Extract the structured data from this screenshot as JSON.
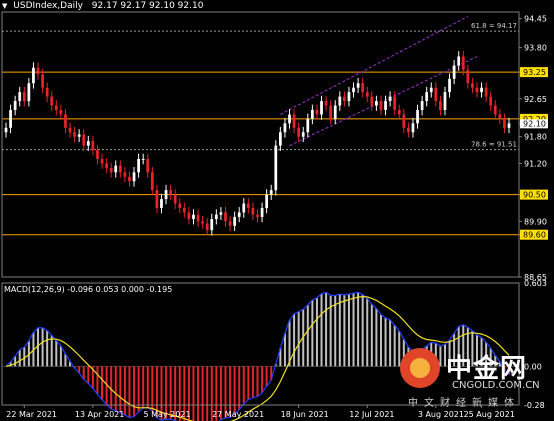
{
  "header": {
    "symbol": "USDIndex,Daily",
    "ohlc": "92.17 92.17 92.10 92.10"
  },
  "colors": {
    "background": "#000000",
    "bull": "#ffffff",
    "bear": "#e8232a",
    "hline": "#ffa500",
    "dash": "#a0a0a0",
    "channel": "#9933cc",
    "macd_hist": "#c0c0c0",
    "macd_hist_neg": "#e8232a",
    "signal": "#f0e020",
    "macd_line": "#2040ff",
    "label_bg": "#ffe000"
  },
  "chart_data": [
    {
      "type": "candlestick",
      "title": "USDIndex,Daily",
      "ylim": [
        88.65,
        94.6
      ],
      "yticks": [
        "94.45",
        "93.80",
        "93.25",
        "92.65",
        "92.20",
        "92.10",
        "91.80",
        "91.20",
        "90.50",
        "89.90",
        "89.60",
        "88.65"
      ],
      "xticks": [
        "22 Mar 2021",
        "13 Apr 2021",
        "5 May 2021",
        "27 May 2021",
        "18 Jun 2021",
        "12 Jul 2021",
        "3 Aug 2021",
        "25 Aug 2021"
      ],
      "horizontal_lines": [
        {
          "label": "93.25",
          "value": 93.25,
          "style": "solid",
          "highlight": true
        },
        {
          "label": "92.20",
          "value": 92.2,
          "style": "solid",
          "highlight": true
        },
        {
          "label": "90.50",
          "value": 90.5,
          "style": "solid",
          "highlight": true
        },
        {
          "label": "89.60",
          "value": 89.6,
          "style": "solid",
          "highlight": true
        },
        {
          "label": "61.8 = 94.17",
          "value": 94.17,
          "style": "dashed"
        },
        {
          "label": "78.6 = 91.51",
          "value": 91.51,
          "style": "dashed"
        }
      ],
      "current_price": "92.10",
      "closes": [
        92.0,
        92.4,
        92.6,
        92.8,
        92.6,
        93.0,
        93.35,
        93.2,
        92.9,
        92.7,
        92.5,
        92.4,
        92.3,
        92.0,
        91.9,
        91.8,
        91.85,
        91.6,
        91.7,
        91.5,
        91.3,
        91.2,
        91.1,
        91.0,
        91.15,
        91.0,
        90.9,
        90.8,
        91.0,
        91.3,
        91.3,
        91.0,
        90.6,
        90.2,
        90.4,
        90.6,
        90.5,
        90.3,
        90.2,
        90.1,
        89.95,
        90.05,
        89.9,
        89.85,
        89.7,
        89.95,
        90.05,
        90.1,
        89.9,
        89.8,
        90.0,
        90.1,
        90.3,
        90.2,
        90.05,
        90.0,
        90.2,
        90.5,
        90.6,
        91.6,
        91.9,
        92.1,
        92.3,
        92.0,
        91.8,
        91.9,
        92.2,
        92.4,
        92.3,
        92.6,
        92.5,
        92.2,
        92.5,
        92.7,
        92.6,
        92.8,
        92.9,
        93.0,
        92.8,
        92.7,
        92.5,
        92.6,
        92.4,
        92.6,
        92.7,
        92.4,
        92.3,
        92.0,
        91.9,
        92.1,
        92.4,
        92.6,
        92.8,
        92.9,
        92.6,
        92.4,
        92.8,
        93.1,
        93.4,
        93.6,
        93.3,
        93.0,
        92.9,
        92.8,
        92.9,
        92.7,
        92.5,
        92.3,
        92.2,
        92.0,
        92.1
      ],
      "macd_params": "MACD(12,26,9)",
      "macd_values": [
        "-0.096",
        "0.053",
        "0.000",
        "-0.195"
      ],
      "macd_ylim": [
        -0.28,
        0.603
      ],
      "macd_yticks": [
        "0.603",
        "0.00",
        "-0.28"
      ]
    }
  ],
  "watermark": {
    "brand_cn": "中金网",
    "brand_en": "CNGOLD.COM.CN",
    "slogan": "中文财经新媒体"
  }
}
